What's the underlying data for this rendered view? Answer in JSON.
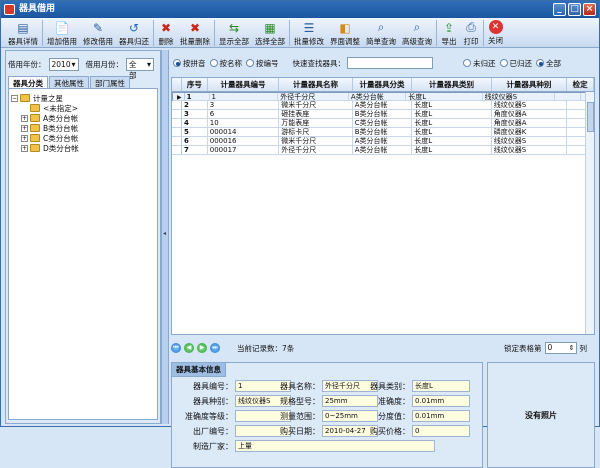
{
  "window": {
    "title": "器具借用"
  },
  "toolbar": [
    {
      "label": "器具详情",
      "icon": "details-icon"
    },
    {
      "label": "增加借用",
      "icon": "add-document-icon"
    },
    {
      "label": "修改借用",
      "icon": "edit-document-icon"
    },
    {
      "label": "器具归还",
      "icon": "return-icon"
    },
    {
      "label": "删除",
      "icon": "delete-icon"
    },
    {
      "label": "批量删除",
      "icon": "batch-delete-icon"
    },
    {
      "label": "显示全部",
      "icon": "show-all-icon"
    },
    {
      "label": "选择全部",
      "icon": "select-all-icon"
    },
    {
      "label": "批量修改",
      "icon": "batch-edit-icon"
    },
    {
      "label": "界面调整",
      "icon": "layout-icon"
    },
    {
      "label": "简单查询",
      "icon": "search-icon"
    },
    {
      "label": "高级查询",
      "icon": "advanced-search-icon"
    },
    {
      "label": "导出",
      "icon": "export-icon"
    },
    {
      "label": "打印",
      "icon": "print-icon"
    },
    {
      "label": "关闭",
      "icon": "close-icon"
    }
  ],
  "left": {
    "year_label": "借用年份：",
    "year_value": "2010",
    "month_label": "借用月份：",
    "month_value": "全部",
    "tabs": [
      "器具分类",
      "其他属性",
      "部门属性"
    ],
    "tree": {
      "root": "计量之星",
      "children": [
        "<未指定>",
        "A类分台帐",
        "B类分台帐",
        "C类分台帐",
        "D类分台帐"
      ]
    }
  },
  "filter": {
    "radios": [
      "按拼音",
      "按名称",
      "按编号"
    ],
    "quick_label": "快速查找器具：",
    "status_radios": [
      "未归还",
      "已归还",
      "全部"
    ]
  },
  "grid": {
    "columns": [
      "序号",
      "计量器具编号",
      "计量器具名称",
      "计量器具分类",
      "计量器具类别",
      "计量器具种别",
      "检定"
    ],
    "rows": [
      [
        "1",
        "1",
        "外径千分尺",
        "A类分台帐",
        "长度L",
        "线纹仪器S"
      ],
      [
        "2",
        "3",
        "微米千分尺",
        "A类分台帐",
        "长度L",
        "线纹仪器S"
      ],
      [
        "3",
        "6",
        "砸挂表座",
        "B类分台帐",
        "长度L",
        "角度仪器A"
      ],
      [
        "4",
        "10",
        "万能表座",
        "C类分台帐",
        "长度L",
        "角度仪器A"
      ],
      [
        "5",
        "000014",
        "游标卡尺",
        "B类分台帐",
        "长度L",
        "磷度仪器K"
      ],
      [
        "6",
        "000016",
        "微米千分尺",
        "A类分台帐",
        "长度L",
        "线纹仪器S"
      ],
      [
        "7",
        "000017",
        "外径千分尺",
        "A类分台帐",
        "长度L",
        "线纹仪器S"
      ]
    ]
  },
  "nav": {
    "count_label": "当前记录数：7条",
    "colwidth_label": "锁定表格第",
    "colwidth_value": "0",
    "colwidth_unit": "列"
  },
  "info": {
    "title": "器具基本信息",
    "fields": [
      {
        "label": "器具编号：",
        "value": "1"
      },
      {
        "label": "器具名称：",
        "value": "外径千分尺"
      },
      {
        "label": "器具类别：",
        "value": "长度L"
      },
      {
        "label": "器具种别：",
        "value": "线纹仪器S"
      },
      {
        "label": "规格型号：",
        "value": "25mm"
      },
      {
        "label": "准确度：",
        "value": "0.01mm"
      },
      {
        "label": "准确度等级：",
        "value": ""
      },
      {
        "label": "测量范围：",
        "value": "0~25mm"
      },
      {
        "label": "分度值：",
        "value": "0.01mm"
      },
      {
        "label": "出厂编号：",
        "value": ""
      },
      {
        "label": "购买日期：",
        "value": "2010-04-27"
      },
      {
        "label": "购买价格：",
        "value": "0"
      },
      {
        "label": "制造厂家：",
        "value": "上量"
      }
    ],
    "photo": "没有照片"
  },
  "colors": {
    "title": "#1c56a1",
    "accent": "#8aa9cf"
  }
}
